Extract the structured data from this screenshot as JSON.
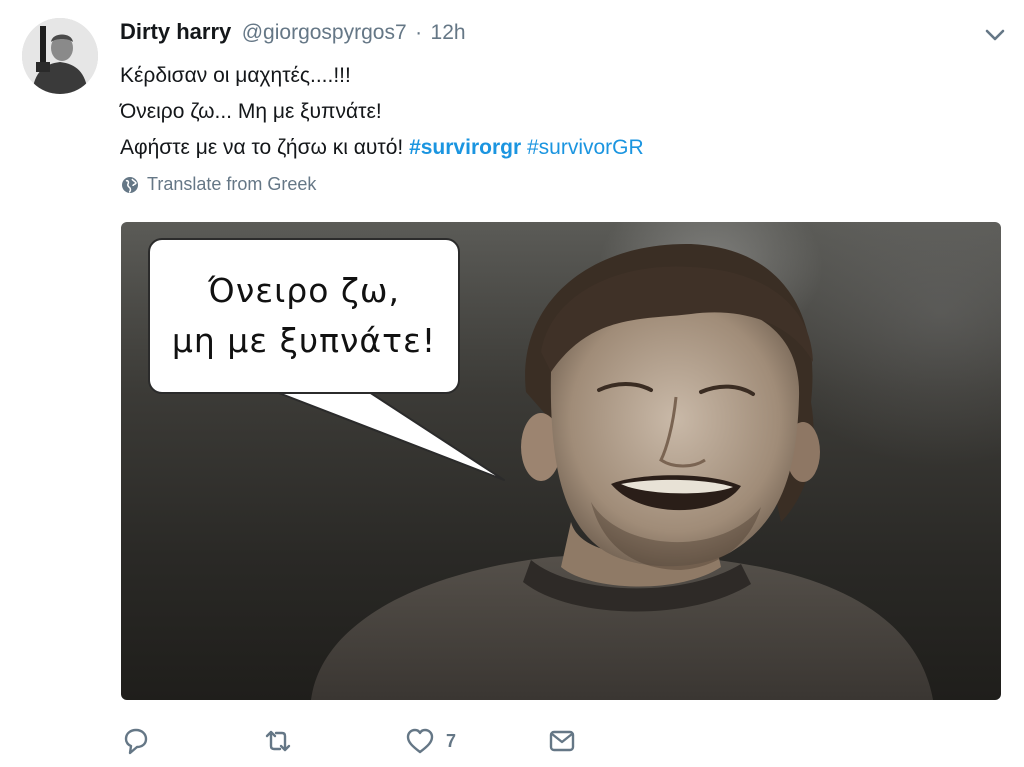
{
  "tweet": {
    "author_name": "Dirty harry",
    "handle": "@giorgospyrgos7",
    "separator": "·",
    "time": "12h",
    "lines": [
      "Κέρδισαν οι μαχητές....!!!",
      "Όνειρο ζω... Μη με ξυπνάτε!",
      "Αφήστε με να το ζήσω κι αυτό!"
    ],
    "hashtags": [
      "#survirorgr",
      "#survivorGR"
    ],
    "translate_label": "Translate from Greek",
    "avatar_icon": "person-with-revolver",
    "caret_icon": "chevron-down-icon"
  },
  "media": {
    "bubble_lines": [
      "Όνειρο ζω,",
      "μη με ξυπνάτε!"
    ]
  },
  "actions": {
    "reply_icon": "reply-icon",
    "retweet_icon": "retweet-icon",
    "like_icon": "like-icon",
    "like_count": "7",
    "message_icon": "message-icon"
  },
  "colors": {
    "text": "#14171a",
    "secondary": "#657786",
    "link": "#1b95e0",
    "icon": "#657786"
  }
}
